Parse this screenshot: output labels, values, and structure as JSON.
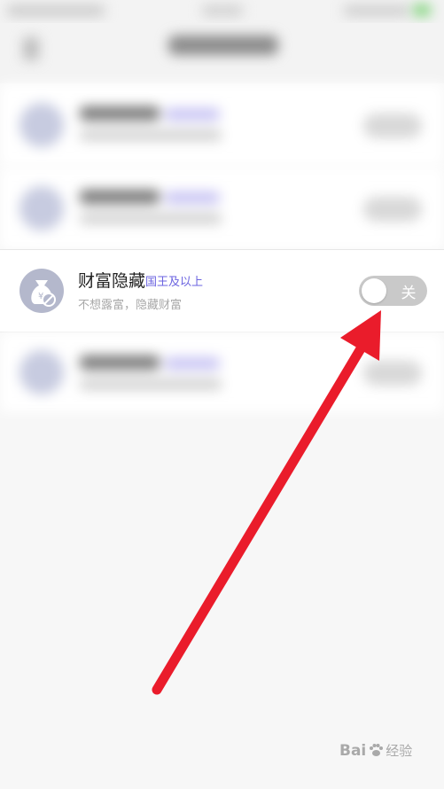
{
  "wealth_setting": {
    "title": "财富隐藏",
    "tag": "国王及以上",
    "subtitle": "不想露富，隐藏财富",
    "toggle_label": "关",
    "toggle_on": false
  },
  "watermark": {
    "brand": "Bai",
    "brand_tail": "经验"
  },
  "colors": {
    "tag": "#6b63e0",
    "arrow": "#ea1c2b",
    "toggle_off": "#c9c9c9"
  }
}
